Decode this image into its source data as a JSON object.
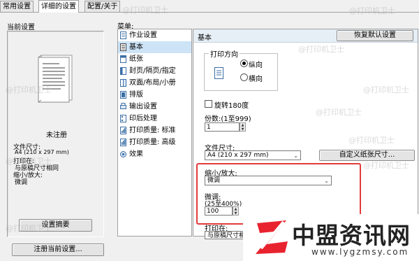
{
  "tabs": [
    "常用设置",
    "详细的设置",
    "配置/关于"
  ],
  "left": {
    "group_label": "当前设置",
    "doc_name": "未注册",
    "paper_size_label": "文件尺寸:",
    "paper_size_value": "A4 (210 x 297 mm)",
    "print_on_label": "打印在:",
    "print_on_value": "与原稿尺寸相同",
    "scale_label": "缩小/放大:",
    "scale_value": "微调",
    "settings_summary_button": "设置摘要",
    "register_button": "注册当前设置..."
  },
  "menu": {
    "label": "菜单:",
    "items": [
      {
        "label": "作业设置",
        "icon": "job-settings-icon"
      },
      {
        "label": "基本",
        "icon": "basic-icon"
      },
      {
        "label": "纸张",
        "icon": "paper-icon"
      },
      {
        "label": "封页/隔页/指定",
        "icon": "cover-icon"
      },
      {
        "label": "双面/布局/小册",
        "icon": "duplex-icon"
      },
      {
        "label": "排版",
        "icon": "layout-icon"
      },
      {
        "label": "输出设置",
        "icon": "output-icon"
      },
      {
        "label": "印后处理",
        "icon": "finishing-icon"
      },
      {
        "label": "打印质量: 标准",
        "icon": "quality-standard-icon"
      },
      {
        "label": "打印质量: 高级",
        "icon": "quality-advanced-icon"
      },
      {
        "label": "效果",
        "icon": "effects-icon"
      }
    ],
    "selected_index": 1
  },
  "panel": {
    "title": "基本",
    "restore_button": "恢复默认设置",
    "orientation": {
      "legend": "打印方向",
      "portrait": "纵向",
      "landscape": "横向",
      "selected": "纵向"
    },
    "rotate_label": "旋转180度",
    "copies": {
      "label": "份数:(1至999)",
      "value": "1"
    },
    "paper_size": {
      "label": "文件尺寸:",
      "value": "A4 (210 x 297 mm)"
    },
    "custom_paper_button": "自定义纸张尺寸...",
    "scale": {
      "label": "缩小/放大:",
      "value": "微调"
    },
    "fine_tune": {
      "label": "微调:",
      "range": "(25至400%)",
      "value": "100"
    },
    "print_on": {
      "label": "打印在:",
      "value": "与原稿尺寸相"
    }
  },
  "watermark_text": "@打印机卫士",
  "logo": {
    "title": "中盟资讯网",
    "url": "www.lygzmsy.com"
  },
  "colors": {
    "highlight": "#e33b3b",
    "selection": "#cde4f7",
    "header": "#e6eef6"
  }
}
